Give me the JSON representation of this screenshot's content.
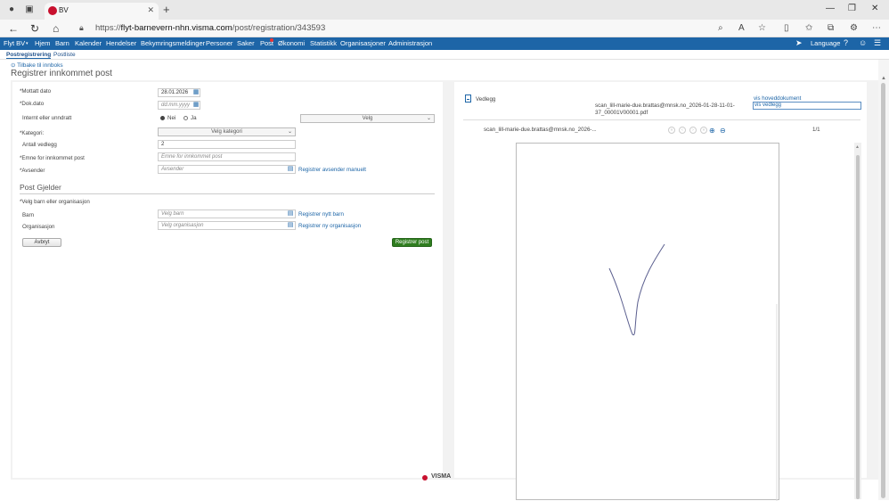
{
  "browser": {
    "tab_title": "BV",
    "url_prefix": "https://",
    "url_host": "flyt-barnevern-nhn.visma.com",
    "url_path": "/post/registration/343593"
  },
  "nav": {
    "items": [
      "Flyt BV",
      "Hjem",
      "Barn",
      "Kalender",
      "Hendelser",
      "Bekymringsmeldinger",
      "Personer",
      "Saker",
      "Post",
      "Økonomi",
      "Statistikk",
      "Organisasjoner",
      "Administrasjon"
    ],
    "language": "Language"
  },
  "subnav": {
    "registration": "Postregistrering",
    "list": "Postliste"
  },
  "page": {
    "back_link": "Tilbake til innboks",
    "title": "Registrer innkommet post"
  },
  "form": {
    "received_label": "*Mottatt dato",
    "received_value": "28.01.2026",
    "doc_date_label": "*Dok.dato",
    "doc_date_placeholder": "dd.mm.yyyy",
    "internal_label": "Internt eller unndratt",
    "radio_no": "Nei",
    "radio_yes": "Ja",
    "velg_select": "Velg",
    "category_label": "*Kategori:",
    "category_select": "Velg kategori",
    "attachments_label": "Antall vedlegg",
    "attachments_value": "2",
    "subject_label": "*Emne for innkommet post",
    "subject_placeholder": "Emne for innkommet post",
    "sender_label": "*Avsender",
    "sender_placeholder": "Avsender",
    "sender_link": "Registrer avsender manuelt",
    "section_title": "Post Gjelder",
    "child_or_org_label": "*Velg barn eller organisasjon",
    "child_label": "Barn",
    "child_placeholder": "Velg barn",
    "child_link": "Registrer nytt barn",
    "org_label": "Organisasjon",
    "org_placeholder": "Velg organisasjon",
    "org_link": "Registrer ny organisasjon",
    "cancel": "Avbryt",
    "submit": "Registrer post"
  },
  "viewer": {
    "attachment_label": "Vedlegg",
    "file_name_line1": "scan_lill-marie-due.brattas@mnsk.no_2026-01-28-11-01-",
    "file_name_line2": "37_00001V00001.pdf",
    "main_doc_link": "vis hoveddokument",
    "attachment_link": "vis vedlegg",
    "toolbar_file": "scan_lill-marie-due.brattas@mnsk.no_2026-...",
    "page_count": "1/1"
  },
  "footer": {
    "brand": "VISMA"
  },
  "colors": {
    "nav_blue": "#1d65a7",
    "primary_green": "#2f7d1f",
    "brand_red": "#c8102e"
  }
}
